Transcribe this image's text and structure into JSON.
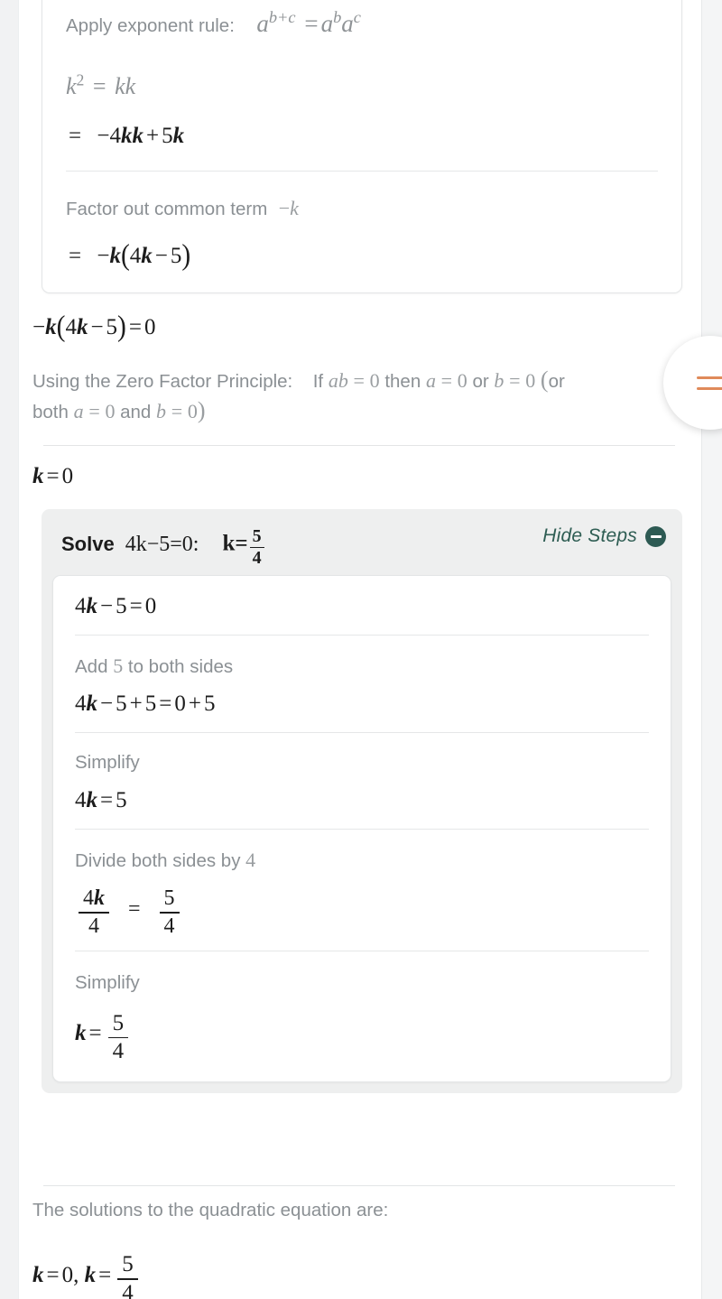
{
  "theme": {
    "page_background": "#ffffff",
    "card_border": "#e3e5e6",
    "panel_background": "#eeefef",
    "muted_text": "#8b9094",
    "body_text": "#1c1c1c",
    "accent_teal": "#2d5a53",
    "accent_orange": "#e08a5a"
  },
  "top_card": {
    "exponent_rule": {
      "label": "Apply exponent rule:",
      "formula_plain": "a^(b+c) = a^b a^c",
      "base": "a",
      "exponent_left": "b+c",
      "equals": "=",
      "rhs_base_1": "a",
      "rhs_exp_1": "b",
      "rhs_base_2": "a",
      "rhs_exp_2": "c"
    },
    "squared_identity": {
      "lhs_var": "k",
      "lhs_exp": "2",
      "equals": "=",
      "rhs": "kk",
      "plain": "k^2 = kk"
    },
    "expanded_result": {
      "plain": "= -4kk + 5k",
      "equals": "=",
      "terms": "−4kk + 5k"
    },
    "factor_step": {
      "label_text": "Factor out common term",
      "label_math": "−k",
      "result_plain": "= -k(4k - 5)",
      "result_equals": "=",
      "result_body": "−k(4k − 5)"
    }
  },
  "factored_equation": {
    "plain": "-k(4k - 5) = 0",
    "text": "−k(4k − 5) = 0"
  },
  "zero_factor": {
    "label": "Using the Zero Factor Principle:",
    "statement_plain": "If ab = 0 then a = 0 or b = 0 (or both a = 0 and b = 0)",
    "line_1": "If ab = 0 then a = 0 or b =",
    "line_2": "0 (or both a = 0 and b = 0)"
  },
  "first_solution": {
    "plain": "k = 0",
    "variable": "k",
    "equals": "=",
    "value": "0"
  },
  "solve_panel": {
    "title_word": "Solve",
    "equation_plain": "4k - 5 = 0:",
    "equation": "4k − 5 = 0:",
    "result_variable": "k",
    "result_equals": "=",
    "result_numerator": "5",
    "result_denominator": "4",
    "result_plain": "k = 5/4",
    "hide_steps_label": "Hide Steps",
    "hide_steps_icon": "minus-circle-icon",
    "steps": [
      {
        "type": "equation",
        "label": null,
        "math_plain": "4k - 5 = 0",
        "math": "4k − 5 = 0"
      },
      {
        "type": "labeled",
        "label_prefix": "Add",
        "label_number": "5",
        "label_suffix": "to both sides",
        "label_plain": "Add 5 to both sides",
        "math_plain": "4k - 5 + 5 = 0 + 5",
        "math": "4k − 5 + 5 = 0 + 5"
      },
      {
        "type": "labeled",
        "label_prefix": "Simplify",
        "label_number": null,
        "label_suffix": null,
        "label_plain": "Simplify",
        "math_plain": "4k = 5",
        "math": "4k = 5"
      },
      {
        "type": "fraction",
        "label_prefix": "Divide both sides by",
        "label_number": "4",
        "label_suffix": null,
        "label_plain": "Divide both sides by 4",
        "math_plain": "4k/4 = 5/4",
        "lhs_numerator": "4k",
        "lhs_denominator": "4",
        "equals": "=",
        "rhs_numerator": "5",
        "rhs_denominator": "4"
      },
      {
        "type": "fraction_result",
        "label_prefix": "Simplify",
        "label_number": null,
        "label_suffix": null,
        "label_plain": "Simplify",
        "math_plain": "k = 5/4",
        "variable": "k",
        "equals": "=",
        "numerator": "5",
        "denominator": "4"
      }
    ]
  },
  "conclusion": {
    "label": "The solutions to the quadratic equation are:",
    "solutions_plain": "k = 0, k = 5/4",
    "first_var": "k",
    "first_value": "0",
    "separator": ",",
    "second_var": "k",
    "second_numerator": "5",
    "second_denominator": "4"
  },
  "float_button": {
    "icon": "equals-icon",
    "label": "equals"
  }
}
